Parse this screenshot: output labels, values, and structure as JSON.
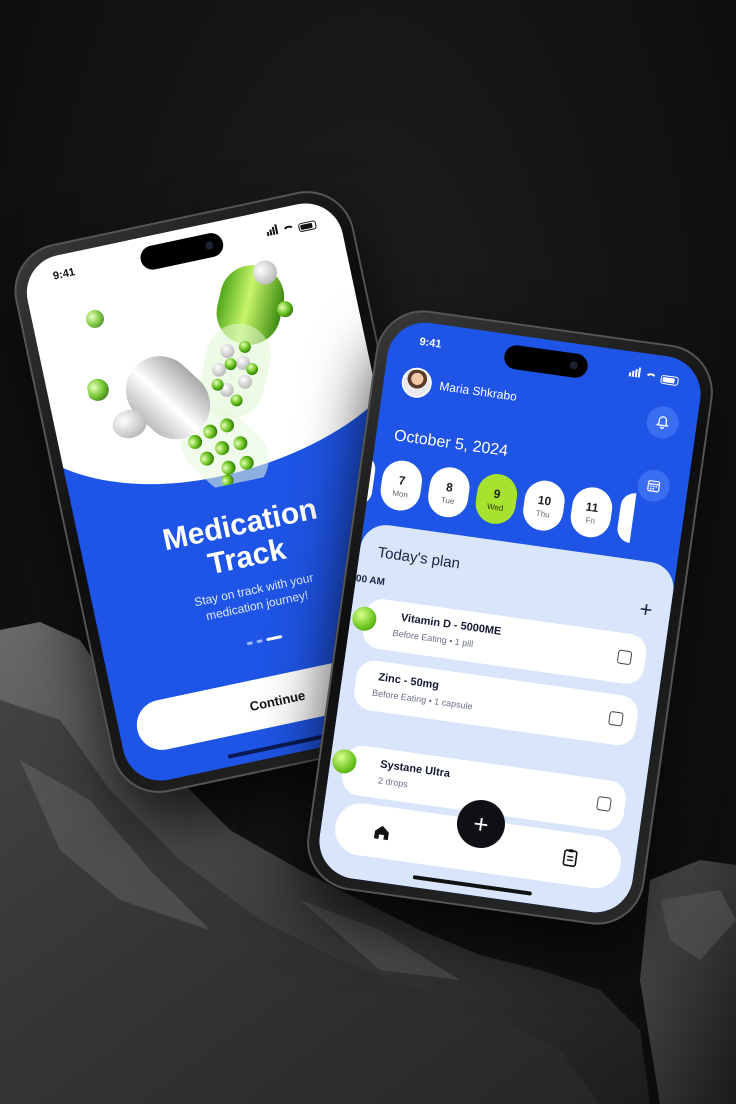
{
  "colors": {
    "brand_blue": "#1f55e6",
    "accent_green": "#a6e22e",
    "background": "#121212",
    "plan_panel": "#d9e5fb"
  },
  "onboarding": {
    "status_time": "9:41",
    "title_line1": "Medication",
    "title_line2": "Track",
    "subtitle_line1": "Stay on track with your",
    "subtitle_line2": "medication journey!",
    "page_indicator": {
      "count": 3,
      "active_index": 2
    },
    "continue_label": "Continue",
    "continue_icon": "double-chevron-right-icon"
  },
  "dashboard": {
    "status_time": "9:41",
    "user_name": "Maria Shkrabo",
    "date": "October 5, 2024",
    "icons": {
      "notifications": "bell-icon",
      "calendar": "calendar-icon"
    },
    "week": [
      {
        "num": "7",
        "label": "Mon"
      },
      {
        "num": "8",
        "label": "Tue"
      },
      {
        "num": "9",
        "label": "Wed",
        "selected": true
      },
      {
        "num": "10",
        "label": "Thu"
      },
      {
        "num": "11",
        "label": "Fri"
      }
    ],
    "plan": {
      "title": "Today's plan",
      "add_label": "+",
      "time_label": "00 AM",
      "items": [
        {
          "name": "Vitamin D - 5000ME",
          "timing": "Before Eating",
          "dose": "1 pill",
          "checked": false
        },
        {
          "name": "Zinc - 50mg",
          "timing": "Before Eating",
          "dose": "1 capsule",
          "checked": false
        },
        {
          "name": "Systane Ultra",
          "dose": "2 drops",
          "checked": false
        }
      ]
    },
    "nav": {
      "home_icon": "home-icon",
      "add_label": "+",
      "records_icon": "clipboard-icon"
    }
  }
}
